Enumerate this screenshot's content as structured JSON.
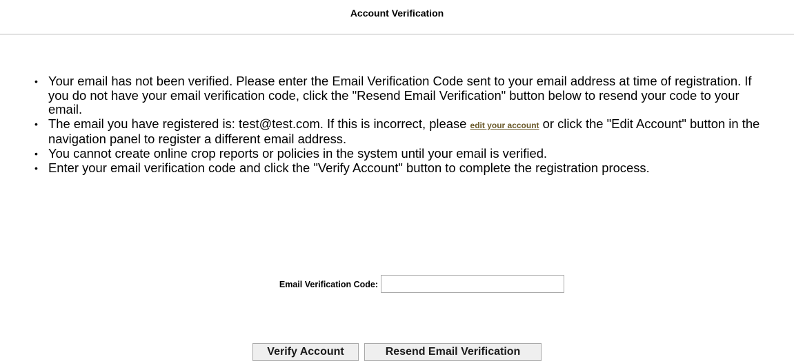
{
  "page": {
    "title": "Account Verification"
  },
  "bullets": [
    {
      "text": "Your email has not been verified. Please enter the Email Verification Code sent to your email address at time of registration. If you do not have your email verification code, click the \"Resend Email Verification\" button below to resend your code to your email."
    },
    {
      "text_before": "The email you have registered is: test@test.com. If this is incorrect, please ",
      "link_label": "edit your account",
      "text_after": " or click the \"Edit Account\" button in the navigation panel to register a different email address."
    },
    {
      "text": "You cannot create online crop reports or policies in the system until your email is verified."
    },
    {
      "text": "Enter your email verification code and click the \"Verify Account\" button to complete the registration process."
    }
  ],
  "form": {
    "code_label": "Email Verification Code:",
    "code_value": ""
  },
  "buttons": {
    "verify_label": "Verify Account",
    "resend_label": "Resend Email Verification"
  }
}
